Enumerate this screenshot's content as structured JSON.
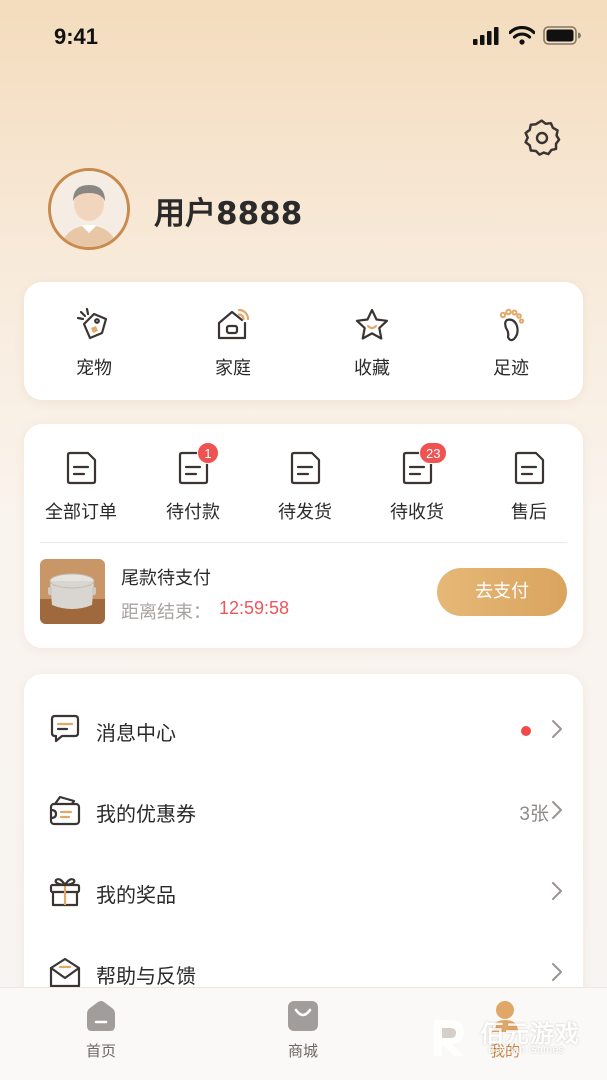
{
  "status_bar": {
    "time": "9:41"
  },
  "profile": {
    "username": "用户8888"
  },
  "quick_actions": [
    {
      "label": "宠物",
      "icon": "pet-tag-icon"
    },
    {
      "label": "家庭",
      "icon": "smart-home-icon"
    },
    {
      "label": "收藏",
      "icon": "star-icon"
    },
    {
      "label": "足迹",
      "icon": "footprint-icon"
    }
  ],
  "orders": {
    "items": [
      {
        "label": "全部订单",
        "icon": "order-doc-icon",
        "badge": ""
      },
      {
        "label": "待付款",
        "icon": "order-doc-icon",
        "badge": "1"
      },
      {
        "label": "待发货",
        "icon": "order-doc-icon",
        "badge": ""
      },
      {
        "label": "待收货",
        "icon": "order-doc-icon",
        "badge": "23"
      },
      {
        "label": "售后",
        "icon": "order-doc-icon",
        "badge": ""
      }
    ],
    "pending": {
      "title": "尾款待支付",
      "countdown_label": "距离结束：",
      "countdown": "12:59:58",
      "pay_label": "去支付"
    }
  },
  "menu": [
    {
      "label": "消息中心",
      "icon": "message-icon",
      "right_text": "",
      "dot": true
    },
    {
      "label": "我的优惠券",
      "icon": "coupon-wallet-icon",
      "right_text": "3张",
      "dot": false
    },
    {
      "label": "我的奖品",
      "icon": "gift-icon",
      "right_text": "",
      "dot": false
    },
    {
      "label": "帮助与反馈",
      "icon": "mail-feedback-icon",
      "right_text": "",
      "dot": false
    }
  ],
  "tabbar": [
    {
      "label": "首页",
      "icon": "home-icon",
      "active": false
    },
    {
      "label": "商城",
      "icon": "shopping-bag-icon",
      "active": false
    },
    {
      "label": "我的",
      "icon": "profile-icon",
      "active": true
    }
  ],
  "watermark": {
    "text": "佰元游戏",
    "sub": "Bayuan Games"
  },
  "colors": {
    "accent": "#c8873f",
    "button": "#e0ad6a",
    "badge": "#f05252",
    "countdown": "#f0555a"
  }
}
